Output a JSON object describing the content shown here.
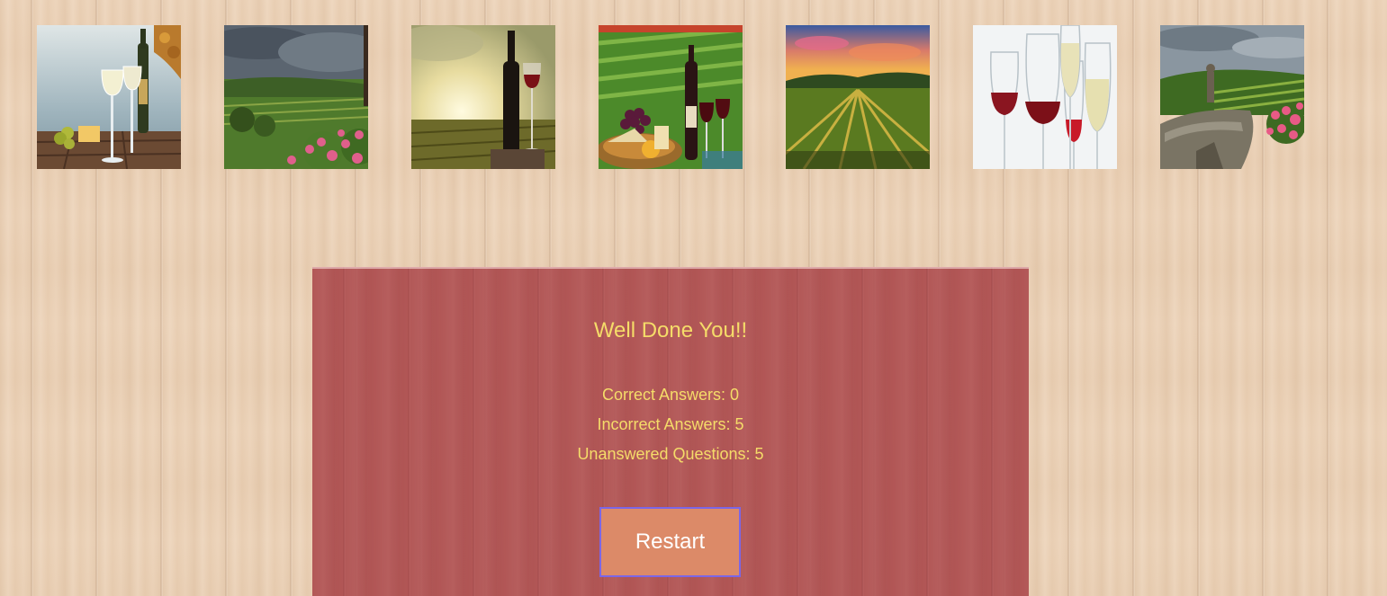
{
  "gallery": {
    "images": [
      {
        "icon": "white-wine-glasses-seaside-image"
      },
      {
        "icon": "vineyard-stormy-sky-image"
      },
      {
        "icon": "wine-bottle-glass-vineyard-sunrise-image"
      },
      {
        "icon": "wine-cheese-grapes-vineyard-image"
      },
      {
        "icon": "vineyard-sunset-rows-image"
      },
      {
        "icon": "assorted-wine-glasses-image"
      },
      {
        "icon": "vineyard-stone-ruins-roses-image"
      }
    ]
  },
  "result": {
    "title": "Well Done You!!",
    "correct_label": "Correct Answers: 0",
    "incorrect_label": "Incorrect Answers: 5",
    "unanswered_label": "Unanswered Questions: 5",
    "restart_label": "Restart"
  },
  "colors": {
    "panel_background": "#ac4a4c",
    "text_accent": "#f5dc69",
    "button_background": "#dc8a68",
    "button_border": "#7b66e6"
  }
}
